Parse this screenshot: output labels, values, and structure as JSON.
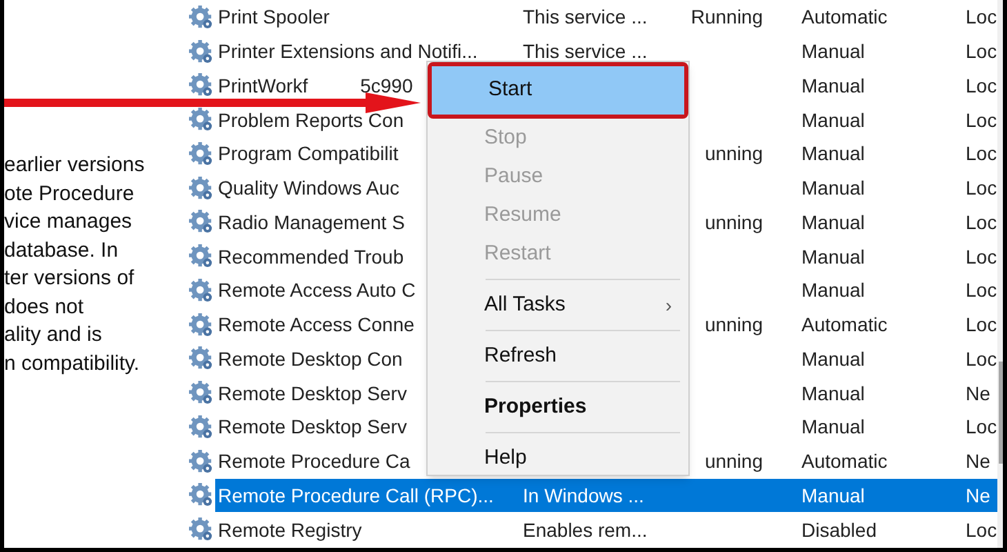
{
  "description_lines": [
    "earlier versions",
    "ote Procedure",
    "vice manages",
    "database. In",
    "ter versions of",
    "does not",
    "ality and is",
    "n compatibility."
  ],
  "services": [
    {
      "name": "Print Spooler",
      "description": "This service ...",
      "status": "Running",
      "startup": "Automatic",
      "log_on": "Loc",
      "selected": false
    },
    {
      "name": "Printer Extensions and Notifi...",
      "description": "This service ...",
      "startup": "Manual",
      "log_on": "Loc",
      "selected": false
    },
    {
      "name": "PrintWorkf",
      "name_2": "5c990",
      "startup": "Manual",
      "log_on": "Loc",
      "selected": false
    },
    {
      "name": "Problem Reports Con",
      "startup": "Manual",
      "log_on": "Loc",
      "selected": false
    },
    {
      "name": "Program Compatibilit",
      "status": "unning",
      "startup": "Manual",
      "log_on": "Loc",
      "selected": false
    },
    {
      "name": "Quality Windows Auc",
      "startup": "Manual",
      "log_on": "Loc",
      "selected": false
    },
    {
      "name": "Radio Management S",
      "status": "unning",
      "startup": "Manual",
      "log_on": "Loc",
      "selected": false
    },
    {
      "name": "Recommended Troub",
      "startup": "Manual",
      "log_on": "Loc",
      "selected": false
    },
    {
      "name": "Remote Access Auto C",
      "startup": "Manual",
      "log_on": "Loc",
      "selected": false
    },
    {
      "name": "Remote Access Conne",
      "status": "unning",
      "startup": "Automatic",
      "log_on": "Loc",
      "selected": false
    },
    {
      "name": "Remote Desktop Con",
      "startup": "Manual",
      "log_on": "Loc",
      "selected": false
    },
    {
      "name": "Remote Desktop Serv",
      "startup": "Manual",
      "log_on": "Ne",
      "selected": false
    },
    {
      "name": "Remote Desktop Serv",
      "startup": "Manual",
      "log_on": "Loc",
      "selected": false
    },
    {
      "name": "Remote Procedure Ca",
      "status": "unning",
      "startup": "Automatic",
      "log_on": "Ne",
      "selected": false
    },
    {
      "name": "Remote Procedure Call (RPC)...",
      "description": "In Windows ...",
      "startup": "Manual",
      "log_on": "Ne",
      "selected": true
    },
    {
      "name": "Remote Registry",
      "description": "Enables rem...",
      "startup": "Disabled",
      "log_on": "Loc",
      "selected": false
    }
  ],
  "context_menu": [
    {
      "kind": "item",
      "label": "Start",
      "selected": true,
      "disabled": false
    },
    {
      "kind": "item",
      "label": "Stop",
      "selected": false,
      "disabled": true
    },
    {
      "kind": "item",
      "label": "Pause",
      "selected": false,
      "disabled": true
    },
    {
      "kind": "item",
      "label": "Resume",
      "selected": false,
      "disabled": true
    },
    {
      "kind": "item",
      "label": "Restart",
      "selected": false,
      "disabled": true
    },
    {
      "kind": "separator"
    },
    {
      "kind": "submenu",
      "label": "All Tasks",
      "arrow": "›",
      "selected": false,
      "disabled": false
    },
    {
      "kind": "separator"
    },
    {
      "kind": "item",
      "label": "Refresh",
      "selected": false,
      "disabled": false
    },
    {
      "kind": "separator"
    },
    {
      "kind": "default",
      "label": "Properties",
      "selected": false,
      "disabled": false
    },
    {
      "kind": "separator"
    },
    {
      "kind": "item",
      "label": "Help",
      "selected": false,
      "disabled": false
    }
  ]
}
